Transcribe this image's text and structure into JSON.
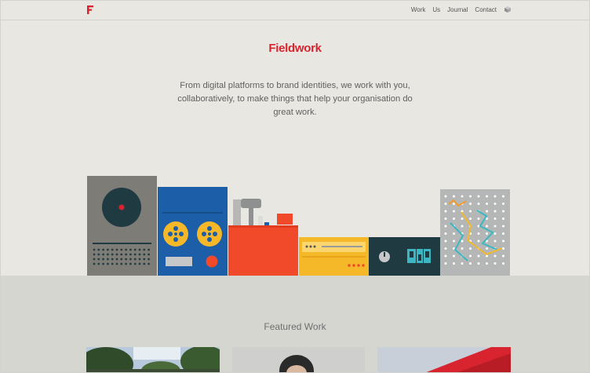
{
  "header": {
    "logo_letter": "F",
    "nav": [
      "Work",
      "Us",
      "Journal",
      "Contact"
    ]
  },
  "hero": {
    "brand": "Fieldwork",
    "tagline": "From digital platforms to brand identities, we work with you, collaboratively, to make things that help your organisation do great work."
  },
  "featured": {
    "heading": "Featured Work",
    "items": [
      {
        "image": "outdoor-trees-photo"
      },
      {
        "image": "person-portrait-photo"
      },
      {
        "image": "red-roof-photo"
      }
    ]
  },
  "colors": {
    "accent": "#d8242f",
    "background": "#e8e7e2",
    "lower_band": "#d6d6d1"
  }
}
